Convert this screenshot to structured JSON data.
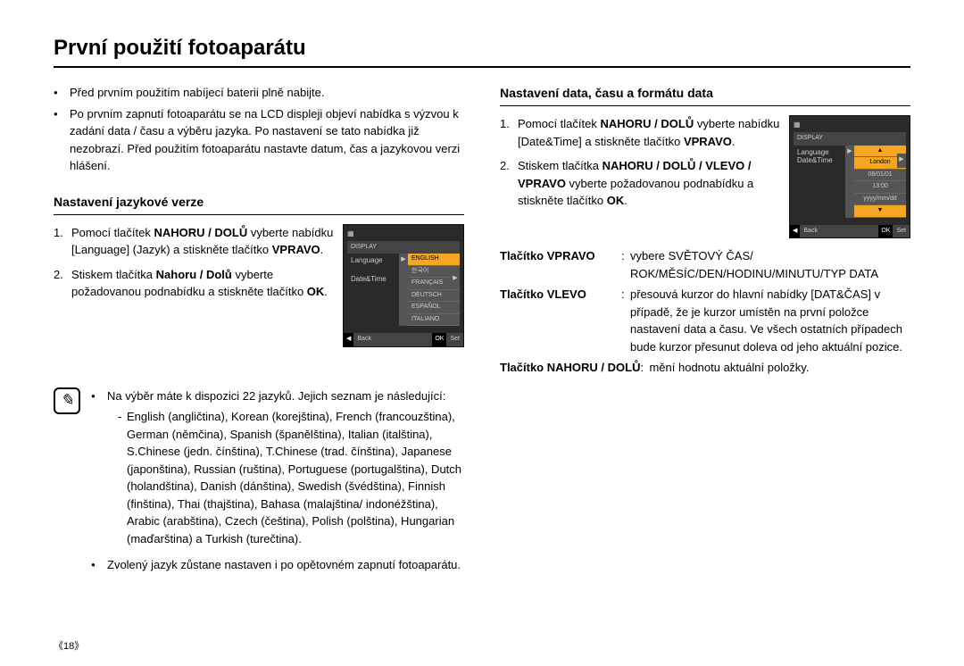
{
  "title": "První použití fotoaparátu",
  "intro_bullets": [
    "Před prvním použitím nabíjecí baterii plně nabijte.",
    "Po prvním zapnutí fotoaparátu se na LCD displeji objeví nabídka s výzvou k zadání data / času a výběru jazyka.  Po nastavení se tato nabídka již nezobrazí. Před použitím fotoaparátu nastavte datum, čas a jazykovou verzi hlášení."
  ],
  "section1": {
    "heading": "Nastavení jazykové verze",
    "step1_a": "Pomocí tlačítek ",
    "step1_b": "NAHORU / DOLŮ",
    "step1_c": " vyberte nabídku [Language] (Jazyk) a stiskněte tlačítko ",
    "step1_d": "VPRAVO",
    "step1_e": ".",
    "step2_a": "Stiskem tlačítka ",
    "step2_b": "Nahoru / Dolů",
    "step2_c": " vyberte požadovanou podnabídku a stiskněte tlačítko ",
    "step2_d": "OK",
    "step2_e": "."
  },
  "lcd1": {
    "display": "DISPLAY",
    "language": "Language",
    "datetime": "Date&Time",
    "opts": [
      "ENGLISH",
      "한국어",
      "FRANÇAIS",
      "DEUTSCH",
      "ESPAÑOL",
      "ITALIANO"
    ],
    "back": "Back",
    "ok": "OK",
    "set": "Set"
  },
  "note": {
    "b1": "Na výběr máte k dispozici 22 jazyků.  Jejich seznam je následující:",
    "sub": "English (angličtina), Korean (korejština), French (francouzština), German (němčina), Spanish (španělština), Italian (italština), S.Chinese (jedn. čínština), T.Chinese (trad. čínština), Japanese (japonština), Russian (ruština), Portuguese (portugalština), Dutch (holandština), Danish (dánština), Swedish (švédština), Finnish (finština), Thai (thajština), Bahasa (malajština/ indonéžština), Arabic (arabština), Czech (čeština), Polish (polština), Hungarian (maďarština) a Turkish (turečtina).",
    "b2": "Zvolený jazyk zůstane nastaven i po opětovném zapnutí fotoaparátu."
  },
  "section2": {
    "heading": "Nastavení data, času a formátu data",
    "step1_a": "Pomocí tlačítek ",
    "step1_b": "NAHORU / DOLŮ",
    "step1_c": " vyberte nabídku [Date&Time] a stiskněte tlačítko ",
    "step1_d": "VPRAVO",
    "step1_e": ".",
    "step2_a": "Stiskem tlačítka ",
    "step2_b": "NAHORU / DOLŮ / VLEVO / VPRAVO",
    "step2_c": " vyberte požadovanou podnabídku a stiskněte tlačítko ",
    "step2_d": "OK",
    "step2_e": "."
  },
  "lcd2": {
    "display": "DISPLAY",
    "language": "Language",
    "datetime": "Date&Time",
    "opts_up": "▲",
    "opt1": "London",
    "opt2": "08/01/01",
    "opt3": "13:00",
    "opt4": "yyyy/mm/dd",
    "opts_down": "▼",
    "back": "Back",
    "ok": "OK",
    "set": "Set"
  },
  "buttons": {
    "r1_lbl": "Tlačítko VPRAVO",
    "r1_val_a": "vybere SVĚTOVÝ ČAS/",
    "r1_val_b": "ROK/MĚSÍC/DEN/HODINU/MINUTU/TYP DATA",
    "r2_lbl": "Tlačítko VLEVO",
    "r2_val": "přesouvá kurzor do hlavní nabídky [DAT&ČAS] v případě, že je kurzor umístěn na první položce nastavení data a času.  Ve všech ostatních případech bude kurzor přesunut doleva od jeho aktuální pozice.",
    "r3_lbl": "Tlačítko NAHORU / DOLŮ",
    "r3_val": "mění hodnotu aktuální položky."
  },
  "page_number": "《18》"
}
